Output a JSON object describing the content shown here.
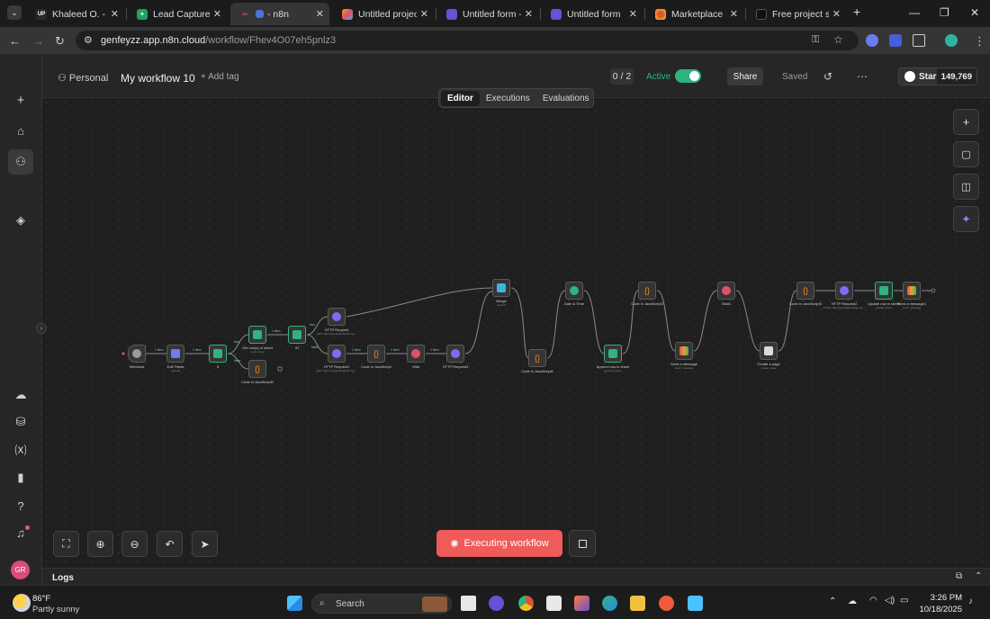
{
  "browser": {
    "tabs": [
      {
        "label": "Khaleed O. - Aut",
        "color": "#2b2b2b",
        "glyph": "UP"
      },
      {
        "label": "Lead Capture Re",
        "color": "#1ea362",
        "glyph": "+"
      },
      {
        "label": "- n8n",
        "color": "#e0436b",
        "glyph": ""
      },
      {
        "label": "Untitled project",
        "color": "#f0a020",
        "glyph": ""
      },
      {
        "label": "Untitled form - (",
        "color": "#6b4fd8",
        "glyph": ""
      },
      {
        "label": "Untitled form",
        "color": "#6b4fd8",
        "glyph": ""
      },
      {
        "label": "Marketplace Pro",
        "color": "#e2553b",
        "glyph": ""
      },
      {
        "label": "Free project sce",
        "color": "#111111",
        "glyph": ""
      }
    ],
    "close_glyph": "✕",
    "new_tab_glyph": "+",
    "url_host": "genfeyzz.app.n8n.cloud",
    "url_path": "/workflow/Fhev4O07eh5pnlz3"
  },
  "header": {
    "project": "Personal",
    "workflow_name": "My workflow 10",
    "add_tag": "+ Add tag",
    "counter": "0 / 2",
    "active_label": "Active",
    "share": "Share",
    "saved": "Saved",
    "star": "Star",
    "star_count": "149,769"
  },
  "view_tabs": [
    "Editor",
    "Executions",
    "Evaluations"
  ],
  "nodes": [
    {
      "label": "Webhook",
      "sub": "",
      "color": "#8e8e8e"
    },
    {
      "label": "Edit Fields",
      "sub": "manual",
      "color": "#6e7cf0"
    },
    {
      "label": "If",
      "sub": "",
      "color": "#2fb37f"
    },
    {
      "label": "Get row(s) in sheet",
      "sub": "read: sheet",
      "color": "#2fb37f"
    },
    {
      "label": "Code in JavaScript4",
      "sub": "",
      "color": "#f08a24"
    },
    {
      "label": "If1",
      "sub": "",
      "color": "#2fb37f"
    },
    {
      "label": "HTTP Request",
      "sub": "GET: https://jsonplaceholder.typ...",
      "color": "#7b6cf0"
    },
    {
      "label": "HTTP Request1",
      "sub": "GET: https://jsonplaceholder.typ...",
      "color": "#7b6cf0"
    },
    {
      "label": "Code in JavaScript",
      "sub": "",
      "color": "#f08a24"
    },
    {
      "label": "Wait",
      "sub": "",
      "color": "#e04f6a"
    },
    {
      "label": "HTTP Request3",
      "sub": "",
      "color": "#7b6cf0"
    },
    {
      "label": "Merge",
      "sub": "append",
      "color": "#3fb3e0"
    },
    {
      "label": "Code in JavaScript1",
      "sub": "",
      "color": "#f08a24"
    },
    {
      "label": "Date & Time",
      "sub": "",
      "color": "#2fb37f"
    },
    {
      "label": "Append row in sheet",
      "sub": "append: sheet",
      "color": "#2fb37f"
    },
    {
      "label": "Code in JavaScript2",
      "sub": "",
      "color": "#f08a24"
    },
    {
      "label": "Send a message",
      "sub": "send: message",
      "color": "#e04f6a"
    },
    {
      "label": "Wait1",
      "sub": "",
      "color": "#e04f6a"
    },
    {
      "label": "Create a page",
      "sub": "create: page",
      "color": "#dcdcdc"
    },
    {
      "label": "Code in JavaScript3",
      "sub": "",
      "color": "#f08a24"
    },
    {
      "label": "HTTP Request2",
      "sub": "POST: https://jsonplaceholder.typ...",
      "color": "#7b6cf0"
    },
    {
      "label": "Update row in sheet",
      "sub": "update: sheet",
      "color": "#2fb37f"
    },
    {
      "label": "Send a message1",
      "sub": "send: message",
      "color": "#e04f6a"
    }
  ],
  "edge_labels": [
    "1 item",
    "1 item",
    "true",
    "false",
    "1 item",
    "true",
    "false",
    "1 item",
    "1 item",
    "1 item"
  ],
  "controls": {
    "executing": "Executing workflow",
    "logs": "Logs"
  },
  "taskbar": {
    "temp": "86°F",
    "weather": "Partly sunny",
    "search": "Search",
    "time": "3:26 PM",
    "date": "10/18/2025"
  },
  "user_initials": "GR"
}
